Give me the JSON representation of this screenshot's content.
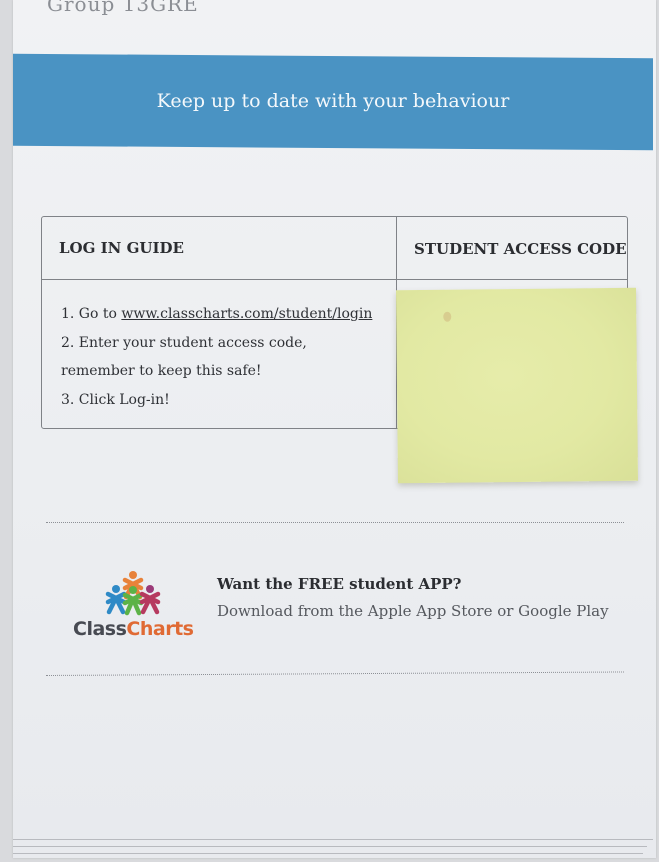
{
  "top_heading_partial": "Group 13GRE",
  "banner": {
    "title": "Keep up to date with your behaviour",
    "color": "#4a93c3"
  },
  "login_table": {
    "left_header": "LOG IN GUIDE",
    "right_header": "STUDENT ACCESS CODE",
    "steps": {
      "step1_prefix": "1. Go to ",
      "step1_link": "www.classcharts.com/student/login",
      "step2_line1": "2. Enter your student access code,",
      "step2_line2": "remember to keep this safe!",
      "step3": "3. Click Log-in!"
    }
  },
  "sticky_note": {
    "color": "#e4eaa6"
  },
  "app_promo": {
    "logo": {
      "word_class": "Class",
      "word_charts": "Charts",
      "icon": "people-group-icon"
    },
    "title": "Want the FREE student APP?",
    "subtitle": "Download from the Apple App Store or Google Play"
  }
}
